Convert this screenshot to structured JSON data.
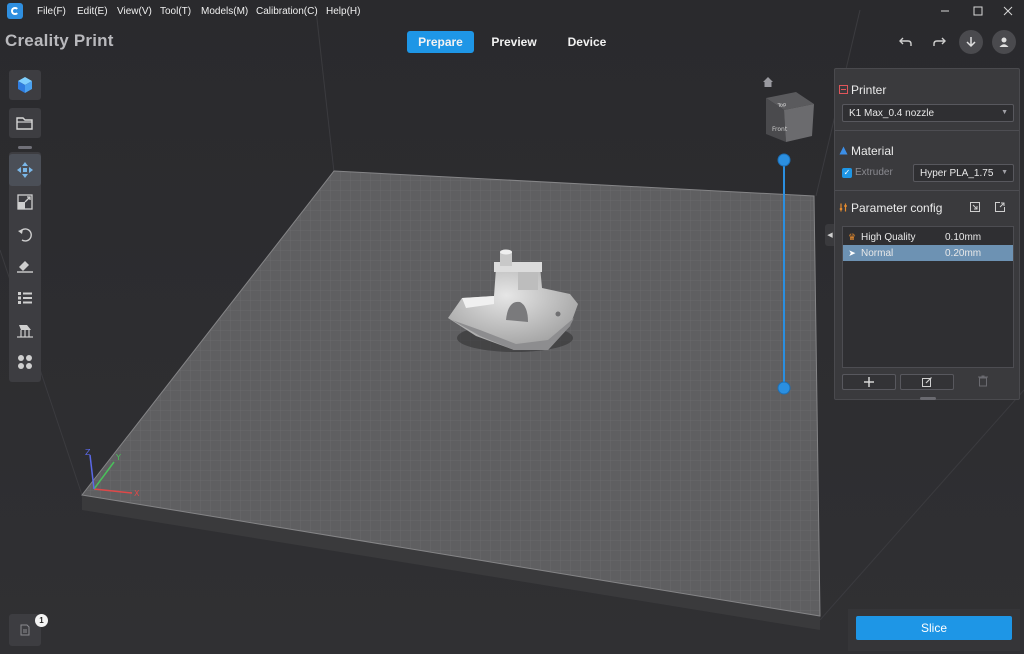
{
  "menubar": {
    "items": [
      "File(F)",
      "Edit(E)",
      "View(V)",
      "Tool(T)",
      "Models(M)",
      "Calibration(C)",
      "Help(H)"
    ],
    "window_controls": [
      "minimize-icon",
      "maximize-icon",
      "close-icon"
    ]
  },
  "header": {
    "app_title": "Creality Print",
    "tabs": [
      {
        "label": "Prepare",
        "active": true
      },
      {
        "label": "Preview",
        "active": false
      },
      {
        "label": "Device",
        "active": false
      }
    ],
    "icons": [
      "undo-icon",
      "redo-icon",
      "download-icon",
      "user-icon"
    ]
  },
  "toolbar": {
    "top": [
      "cube-icon",
      "open-folder-icon"
    ],
    "tools": [
      "move-icon",
      "scale-icon",
      "rotate-icon",
      "lay-on-face-icon",
      "layers-list-icon",
      "support-icon",
      "arrange-icon"
    ]
  },
  "viewcube": {
    "top_label": "Top",
    "front_label": "Front"
  },
  "panel": {
    "printer": {
      "title": "Printer",
      "selected": "K1 Max_0.4 nozzle"
    },
    "material": {
      "title": "Material",
      "extruder_label": "Extruder",
      "extruder_checked": true,
      "selected": "Hyper PLA_1.75"
    },
    "parameter": {
      "title": "Parameter config",
      "profiles": [
        {
          "name": "High Quality",
          "layer_height": "0.10mm",
          "icon": "trophy-icon",
          "selected": false
        },
        {
          "name": "Normal",
          "layer_height": "0.20mm",
          "icon": "rocket-icon",
          "selected": true
        }
      ],
      "buttons": [
        "add-icon",
        "edit-icon",
        "delete-icon"
      ]
    }
  },
  "actions": {
    "slice_label": "Slice"
  },
  "notifications": {
    "count": "1"
  },
  "axes": {
    "x": "X",
    "y": "Y",
    "z": "Z"
  },
  "colors": {
    "accent": "#1e96e6",
    "printer_icon": "#e0555a",
    "material_icon": "#3c8fe8",
    "param_icon": "#e48a2e"
  }
}
